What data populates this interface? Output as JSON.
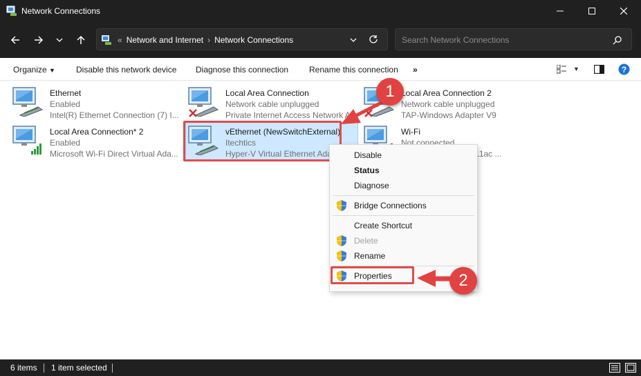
{
  "window": {
    "title": "Network Connections"
  },
  "address": {
    "crumbs": [
      "Network and Internet",
      "Network Connections"
    ],
    "overflow": "«"
  },
  "search": {
    "placeholder": "Search Network Connections"
  },
  "commands": {
    "organize": "Organize",
    "disable": "Disable this network device",
    "diagnose": "Diagnose this connection",
    "rename": "Rename this connection",
    "more": "»"
  },
  "connections": [
    {
      "name": "Ethernet",
      "status": "Enabled",
      "adapter": "Intel(R) Ethernet Connection (7) I...",
      "icon": "ethernet-adapter-icon"
    },
    {
      "name": "Local Area Connection",
      "status": "Network cable unplugged",
      "adapter": "Private Internet Access Network A...",
      "icon": "ethernet-adapter-icon",
      "error": true
    },
    {
      "name": "Local Area Connection 2",
      "status": "Network cable unplugged",
      "adapter": "TAP-Windows Adapter V9",
      "icon": "ethernet-adapter-icon",
      "error": true
    },
    {
      "name": "Local Area Connection* 2",
      "status": "Enabled",
      "adapter": "Microsoft Wi-Fi Direct Virtual Ada...",
      "icon": "wifi-adapter-icon"
    },
    {
      "name": "vEthernet (NewSwitchExternal)",
      "status": "Itechtics",
      "adapter": "Hyper-V Virtual Ethernet Ada...",
      "icon": "ethernet-adapter-icon",
      "selected": true
    },
    {
      "name": "Wi-Fi",
      "status": "Not connected",
      "adapter": "A 802.11ac ...",
      "icon": "wifi-adapter-icon"
    }
  ],
  "context_menu": [
    {
      "label": "Disable",
      "shield": false,
      "style": "normal"
    },
    {
      "label": "Status",
      "shield": false,
      "style": "bold"
    },
    {
      "label": "Diagnose",
      "shield": false,
      "style": "normal"
    },
    {
      "label": "Bridge Connections",
      "shield": true,
      "style": "normal"
    },
    {
      "label": "Create Shortcut",
      "shield": false,
      "style": "normal"
    },
    {
      "label": "Delete",
      "shield": true,
      "style": "disabled"
    },
    {
      "label": "Rename",
      "shield": true,
      "style": "normal"
    },
    {
      "label": "Properties",
      "shield": true,
      "style": "normal"
    }
  ],
  "annotations": {
    "badge1": "1",
    "badge2": "2"
  },
  "status_bar": {
    "items": "6 items",
    "selected": "1 item selected"
  },
  "colors": {
    "accent": "#0078d4",
    "annotation_red": "#e14242",
    "selection": "#cde8ff",
    "dark_chrome": "#202020"
  }
}
